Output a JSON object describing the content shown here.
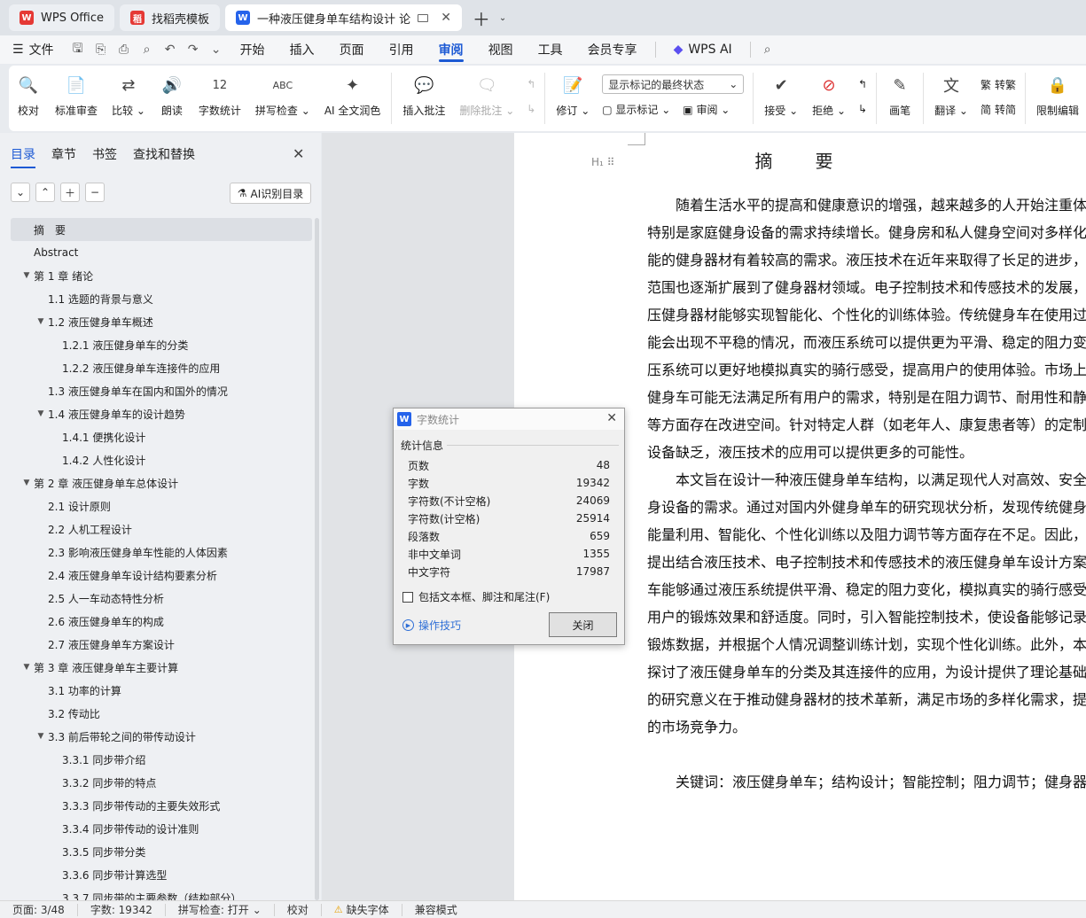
{
  "tabs": [
    {
      "label": "WPS Office",
      "logo": "W",
      "logo_color": "#e53935"
    },
    {
      "label": "找稻壳模板",
      "logo": "稻",
      "logo_color": "#e53935"
    },
    {
      "label": "一种液压健身单车结构设计 论",
      "logo": "W",
      "logo_color": "#2563eb"
    }
  ],
  "menu": {
    "file": "文件",
    "items": [
      "开始",
      "插入",
      "页面",
      "引用",
      "审阅",
      "视图",
      "工具",
      "会员专享"
    ],
    "active": "审阅",
    "ai": "WPS AI"
  },
  "ribbon": {
    "proofread": "校对",
    "standard_review": "标准审查",
    "compare": "比较",
    "read_aloud": "朗读",
    "word_count": "字数统计",
    "spell_check": "拼写检查",
    "ai_polish": "AI 全文润色",
    "insert_comment": "插入批注",
    "delete_comment": "删除批注",
    "track_changes": "修订",
    "markup_select": "显示标记的最终状态",
    "show_markup": "显示标记",
    "review_pane": "审阅",
    "accept": "接受",
    "reject": "拒绝",
    "pen": "画笔",
    "translate": "翻译",
    "to_traditional": "转繁",
    "to_simplified": "转简",
    "restrict_edit": "限制编辑"
  },
  "nav": {
    "tabs": [
      "目录",
      "章节",
      "书签",
      "查找和替换"
    ],
    "active_tab": "目录",
    "ai_toc": "AI识别目录",
    "toc": [
      {
        "label": "摘　要",
        "level": 0,
        "caret": "",
        "selected": true
      },
      {
        "label": "Abstract",
        "level": 0,
        "caret": ""
      },
      {
        "label": "第 1 章  绪论",
        "level": 0,
        "caret": "▼"
      },
      {
        "label": "1.1  选题的背景与意义",
        "level": 1,
        "caret": ""
      },
      {
        "label": "1.2  液压健身单车概述",
        "level": 1,
        "caret": "▼"
      },
      {
        "label": "1.2.1  液压健身单车的分类",
        "level": 2,
        "caret": ""
      },
      {
        "label": "1.2.2  液压健身单车连接件的应用",
        "level": 2,
        "caret": ""
      },
      {
        "label": "1.3  液压健身单车在国内和国外的情况",
        "level": 1,
        "caret": ""
      },
      {
        "label": "1.4  液压健身单车的设计趋势",
        "level": 1,
        "caret": "▼"
      },
      {
        "label": "1.4.1  便携化设计",
        "level": 2,
        "caret": ""
      },
      {
        "label": "1.4.2  人性化设计",
        "level": 2,
        "caret": ""
      },
      {
        "label": "第 2 章  液压健身单车总体设计",
        "level": 0,
        "caret": "▼"
      },
      {
        "label": "2.1  设计原则",
        "level": 1,
        "caret": ""
      },
      {
        "label": "2.2  人机工程设计",
        "level": 1,
        "caret": ""
      },
      {
        "label": "2.3  影响液压健身单车性能的人体因素",
        "level": 1,
        "caret": ""
      },
      {
        "label": "2.4  液压健身单车设计结构要素分析",
        "level": 1,
        "caret": ""
      },
      {
        "label": "2.5  人一车动态特性分析",
        "level": 1,
        "caret": ""
      },
      {
        "label": "2.6  液压健身单车的构成",
        "level": 1,
        "caret": ""
      },
      {
        "label": "2.7  液压健身单车方案设计",
        "level": 1,
        "caret": ""
      },
      {
        "label": "第 3 章   液压健身单车主要计算",
        "level": 0,
        "caret": "▼"
      },
      {
        "label": "3.1  功率的计算",
        "level": 1,
        "caret": ""
      },
      {
        "label": "3.2  传动比",
        "level": 1,
        "caret": ""
      },
      {
        "label": "3.3  前后带轮之间的带传动设计",
        "level": 1,
        "caret": "▼"
      },
      {
        "label": "3.3.1    同步带介绍",
        "level": 2,
        "caret": ""
      },
      {
        "label": "3.3.2    同步带的特点",
        "level": 2,
        "caret": ""
      },
      {
        "label": "3.3.3    同步带传动的主要失效形式",
        "level": 2,
        "caret": ""
      },
      {
        "label": "3.3.4    同步带传动的设计准则",
        "level": 2,
        "caret": ""
      },
      {
        "label": "3.3.5    同步带分类",
        "level": 2,
        "caret": ""
      },
      {
        "label": "3.3.6    同步带计算选型",
        "level": 2,
        "caret": ""
      },
      {
        "label": "3.3.7    同步带的主要参数（结构部分）",
        "level": 2,
        "caret": ""
      }
    ]
  },
  "document": {
    "title": "摘　要",
    "lines": [
      "　　随着生活水平的提高和健康意识的增强，越来越多的人开始注重体育",
      "特别是家庭健身设备的需求持续增长。健身房和私人健身空间对多样化",
      "能的健身器材有着较高的需求。液压技术在近年来取得了长足的进步，",
      "范围也逐渐扩展到了健身器材领域。电子控制技术和传感技术的发展，",
      "压健身器材能够实现智能化、个性化的训练体验。传统健身车在使用过",
      "能会出现不平稳的情况，而液压系统可以提供更为平滑、稳定的阻力变",
      "压系统可以更好地模拟真实的骑行感受，提高用户的使用体验。市场上",
      "健身车可能无法满足所有用户的需求，特别是在阻力调节、耐用性和静",
      "等方面存在改进空间。针对特定人群（如老年人、康复患者等）的定制",
      "设备缺乏，液压技术的应用可以提供更多的可能性。",
      "　　本文旨在设计一种液压健身单车结构，以满足现代人对高效、安全、",
      "身设备的需求。通过对国内外健身单车的研究现状分析，发现传统健身",
      "能量利用、智能化、个性化训练以及阻力调节等方面存在不足。因此，",
      "提出结合液压技术、电子控制技术和传感技术的液压健身单车设计方案",
      "车能够通过液压系统提供平滑、稳定的阻力变化，模拟真实的骑行感受",
      "用户的锻炼效果和舒适度。同时，引入智能控制技术，使设备能够记录",
      "锻炼数据，并根据个人情况调整训练计划，实现个性化训练。此外，本",
      "探讨了液压健身单车的分类及其连接件的应用，为设计提供了理论基础",
      "的研究意义在于推动健身器材的技术革新，满足市场的多样化需求，提",
      "的市场竞争力。",
      "",
      "　　关键词：液压健身单车；结构设计；智能控制；阻力调节；健身器材"
    ]
  },
  "dialog": {
    "title": "字数统计",
    "group": "统计信息",
    "stats": [
      {
        "label": "页数",
        "value": "48"
      },
      {
        "label": "字数",
        "value": "19342"
      },
      {
        "label": "字符数(不计空格)",
        "value": "24069"
      },
      {
        "label": "字符数(计空格)",
        "value": "25914"
      },
      {
        "label": "段落数",
        "value": "659"
      },
      {
        "label": "非中文单词",
        "value": "1355"
      },
      {
        "label": "中文字符",
        "value": "17987"
      }
    ],
    "include_label": "包括文本框、脚注和尾注(F)",
    "tips": "操作技巧",
    "close": "关闭"
  },
  "status": {
    "page": "页面: 3/48",
    "words": "字数: 19342",
    "spell": "拼写检查: 打开",
    "proof": "校对",
    "missing_font": "缺失字体",
    "compat": "兼容模式"
  }
}
